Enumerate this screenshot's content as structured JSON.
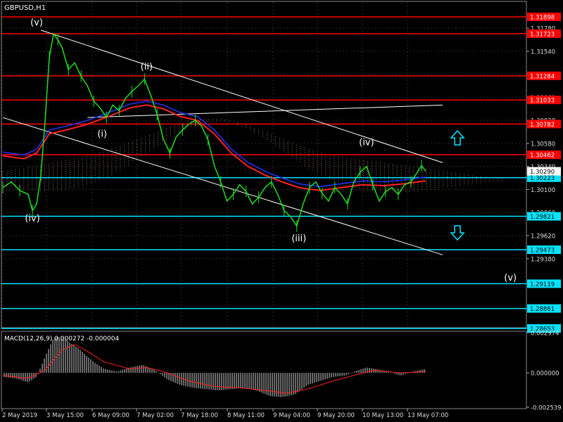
{
  "chart_data": [
    {
      "type": "line",
      "title": "GBPUSD,H1",
      "price_axis_ticks": [
        "1.31780",
        "1.31540",
        "1.31300",
        "1.31060",
        "1.30820",
        "1.30580",
        "1.30340",
        "1.30100",
        "1.29860",
        "1.29620",
        "1.29380"
      ],
      "time_labels": [
        "2 May 2019",
        "3 May 15:00",
        "6 May 09:00",
        "7 May 02:00",
        "7 May 18:00",
        "8 May 11:00",
        "9 May 04:00",
        "9 May 20:00",
        "10 May 13:00",
        "13 May 07:00"
      ],
      "levels": [
        {
          "label": "1.31898",
          "value": 1.31898,
          "color": "#ff0000"
        },
        {
          "label": "1.31723",
          "value": 1.31723,
          "color": "#ff0000"
        },
        {
          "label": "1.31284",
          "value": 1.31284,
          "color": "#ff0000"
        },
        {
          "label": "1.31033",
          "value": 1.31033,
          "color": "#ff0000"
        },
        {
          "label": "1.30782",
          "value": 1.30782,
          "color": "#ff0000"
        },
        {
          "label": "1.30462",
          "value": 1.30462,
          "color": "#ff0000"
        },
        {
          "label": "1.30223",
          "value": 1.30223,
          "color": "#00e5ff"
        },
        {
          "label": "1.29821",
          "value": 1.29821,
          "color": "#00e5ff"
        },
        {
          "label": "1.29473",
          "value": 1.29473,
          "color": "#00e5ff"
        },
        {
          "label": "1.29119",
          "value": 1.29119,
          "color": "#00e5ff"
        },
        {
          "label": "1.28861",
          "value": 1.28861,
          "color": "#00e5ff"
        },
        {
          "label": "1.28653",
          "value": 1.28653,
          "color": "#00e5ff"
        }
      ],
      "current_price": "1.30290",
      "wave_labels": [
        {
          "text": "(v)",
          "t": 0.08,
          "v": 1.3181
        },
        {
          "text": "(i)",
          "t": 0.235,
          "v": 1.3065
        },
        {
          "text": "(ii)",
          "t": 0.34,
          "v": 1.3135
        },
        {
          "text": "(iii)",
          "t": 0.7,
          "v": 1.2956
        },
        {
          "text": "(iv)",
          "t": 0.86,
          "v": 1.3056
        },
        {
          "text": "(iv)",
          "t": 0.07,
          "v": 1.2977
        },
        {
          "text": "(v)",
          "t": 1.2,
          "v": 1.2915
        }
      ],
      "price_series": [
        {
          "t": 0.0,
          "v": 1.3012
        },
        {
          "t": 0.02,
          "v": 1.3018
        },
        {
          "t": 0.04,
          "v": 1.3009
        },
        {
          "t": 0.06,
          "v": 1.3005
        },
        {
          "t": 0.07,
          "v": 1.2988
        },
        {
          "t": 0.08,
          "v": 1.2995
        },
        {
          "t": 0.09,
          "v": 1.3025
        },
        {
          "t": 0.1,
          "v": 1.3082
        },
        {
          "t": 0.11,
          "v": 1.3148
        },
        {
          "t": 0.12,
          "v": 1.3172
        },
        {
          "t": 0.13,
          "v": 1.3166
        },
        {
          "t": 0.14,
          "v": 1.3158
        },
        {
          "t": 0.155,
          "v": 1.3135
        },
        {
          "t": 0.17,
          "v": 1.3142
        },
        {
          "t": 0.185,
          "v": 1.3128
        },
        {
          "t": 0.2,
          "v": 1.3118
        },
        {
          "t": 0.215,
          "v": 1.3102
        },
        {
          "t": 0.23,
          "v": 1.3095
        },
        {
          "t": 0.245,
          "v": 1.3085
        },
        {
          "t": 0.26,
          "v": 1.3098
        },
        {
          "t": 0.275,
          "v": 1.3092
        },
        {
          "t": 0.29,
          "v": 1.3105
        },
        {
          "t": 0.305,
          "v": 1.3112
        },
        {
          "t": 0.32,
          "v": 1.3118
        },
        {
          "t": 0.335,
          "v": 1.3125
        },
        {
          "t": 0.35,
          "v": 1.3108
        },
        {
          "t": 0.365,
          "v": 1.3088
        },
        {
          "t": 0.38,
          "v": 1.3062
        },
        {
          "t": 0.395,
          "v": 1.3048
        },
        {
          "t": 0.41,
          "v": 1.3065
        },
        {
          "t": 0.425,
          "v": 1.3072
        },
        {
          "t": 0.44,
          "v": 1.3078
        },
        {
          "t": 0.455,
          "v": 1.3082
        },
        {
          "t": 0.47,
          "v": 1.3076
        },
        {
          "t": 0.485,
          "v": 1.3062
        },
        {
          "t": 0.5,
          "v": 1.3035
        },
        {
          "t": 0.515,
          "v": 1.3018
        },
        {
          "t": 0.53,
          "v": 1.2998
        },
        {
          "t": 0.545,
          "v": 1.3005
        },
        {
          "t": 0.56,
          "v": 1.3015
        },
        {
          "t": 0.575,
          "v": 1.3008
        },
        {
          "t": 0.59,
          "v": 1.2995
        },
        {
          "t": 0.605,
          "v": 1.3002
        },
        {
          "t": 0.62,
          "v": 1.3012
        },
        {
          "t": 0.635,
          "v": 1.3018
        },
        {
          "t": 0.65,
          "v": 1.3005
        },
        {
          "t": 0.665,
          "v": 1.2988
        },
        {
          "t": 0.68,
          "v": 1.2982
        },
        {
          "t": 0.695,
          "v": 1.2972
        },
        {
          "t": 0.71,
          "v": 1.2995
        },
        {
          "t": 0.725,
          "v": 1.3012
        },
        {
          "t": 0.74,
          "v": 1.3018
        },
        {
          "t": 0.755,
          "v": 1.3006
        },
        {
          "t": 0.77,
          "v": 1.2998
        },
        {
          "t": 0.785,
          "v": 1.3012
        },
        {
          "t": 0.8,
          "v": 1.3005
        },
        {
          "t": 0.815,
          "v": 1.2995
        },
        {
          "t": 0.83,
          "v": 1.3018
        },
        {
          "t": 0.845,
          "v": 1.3028
        },
        {
          "t": 0.86,
          "v": 1.3034
        },
        {
          "t": 0.875,
          "v": 1.3015
        },
        {
          "t": 0.89,
          "v": 1.2998
        },
        {
          "t": 0.905,
          "v": 1.3008
        },
        {
          "t": 0.92,
          "v": 1.3012
        },
        {
          "t": 0.935,
          "v": 1.3005
        },
        {
          "t": 0.95,
          "v": 1.3015
        },
        {
          "t": 0.965,
          "v": 1.3018
        },
        {
          "t": 0.98,
          "v": 1.3028
        },
        {
          "t": 0.99,
          "v": 1.3035
        },
        {
          "t": 1.0,
          "v": 1.3029
        }
      ],
      "ma_series": [
        {
          "t": 0.0,
          "v": 1.3045
        },
        {
          "t": 0.05,
          "v": 1.3042
        },
        {
          "t": 0.08,
          "v": 1.3048
        },
        {
          "t": 0.11,
          "v": 1.3068
        },
        {
          "t": 0.15,
          "v": 1.3072
        },
        {
          "t": 0.2,
          "v": 1.3078
        },
        {
          "t": 0.25,
          "v": 1.3086
        },
        {
          "t": 0.3,
          "v": 1.3095
        },
        {
          "t": 0.34,
          "v": 1.3098
        },
        {
          "t": 0.38,
          "v": 1.3094
        },
        {
          "t": 0.42,
          "v": 1.3086
        },
        {
          "t": 0.46,
          "v": 1.3082
        },
        {
          "t": 0.5,
          "v": 1.3068
        },
        {
          "t": 0.54,
          "v": 1.3048
        },
        {
          "t": 0.58,
          "v": 1.3034
        },
        {
          "t": 0.62,
          "v": 1.3025
        },
        {
          "t": 0.66,
          "v": 1.3018
        },
        {
          "t": 0.7,
          "v": 1.3012
        },
        {
          "t": 0.75,
          "v": 1.3009
        },
        {
          "t": 0.8,
          "v": 1.3012
        },
        {
          "t": 0.85,
          "v": 1.3015
        },
        {
          "t": 0.9,
          "v": 1.3014
        },
        {
          "t": 0.95,
          "v": 1.3016
        },
        {
          "t": 1.0,
          "v": 1.3019
        }
      ],
      "channel_lines": [
        {
          "t1": 0.09,
          "v1": 1.3176,
          "t2": 1.04,
          "v2": 1.3038
        },
        {
          "t1": 0.0,
          "v1": 1.3085,
          "t2": 1.04,
          "v2": 1.2942
        },
        {
          "t1": 0.2,
          "v1": 1.3085,
          "t2": 1.04,
          "v2": 1.3098
        }
      ],
      "arrows": [
        "up",
        "down"
      ],
      "arrow_color": "#00e5ff"
    },
    {
      "type": "bar",
      "title": "MACD(12,26,9) 0.000272 -0.000004",
      "axis_ticks": [
        "0.002974",
        "0.000000",
        "-0.002539"
      ],
      "ylim": [
        -0.002539,
        0.002974
      ],
      "histogram": [
        {
          "t": 0.0,
          "v": -0.0003
        },
        {
          "t": 0.03,
          "v": -0.0004
        },
        {
          "t": 0.06,
          "v": -0.0007
        },
        {
          "t": 0.08,
          "v": -0.0003
        },
        {
          "t": 0.1,
          "v": 0.0012
        },
        {
          "t": 0.12,
          "v": 0.0026
        },
        {
          "t": 0.14,
          "v": 0.0027
        },
        {
          "t": 0.16,
          "v": 0.0022
        },
        {
          "t": 0.18,
          "v": 0.0018
        },
        {
          "t": 0.2,
          "v": 0.0012
        },
        {
          "t": 0.22,
          "v": 0.0007
        },
        {
          "t": 0.24,
          "v": 0.0003
        },
        {
          "t": 0.27,
          "v": 0.0001
        },
        {
          "t": 0.3,
          "v": 0.0004
        },
        {
          "t": 0.33,
          "v": 0.0006
        },
        {
          "t": 0.36,
          "v": 0.0002
        },
        {
          "t": 0.39,
          "v": -0.0005
        },
        {
          "t": 0.42,
          "v": -0.0009
        },
        {
          "t": 0.45,
          "v": -0.0011
        },
        {
          "t": 0.48,
          "v": -0.0012
        },
        {
          "t": 0.51,
          "v": -0.0013
        },
        {
          "t": 0.54,
          "v": -0.0012
        },
        {
          "t": 0.57,
          "v": -0.0011
        },
        {
          "t": 0.6,
          "v": -0.0013
        },
        {
          "t": 0.63,
          "v": -0.0017
        },
        {
          "t": 0.66,
          "v": -0.0018
        },
        {
          "t": 0.69,
          "v": -0.0016
        },
        {
          "t": 0.72,
          "v": -0.0009
        },
        {
          "t": 0.75,
          "v": -0.0006
        },
        {
          "t": 0.78,
          "v": -0.0003
        },
        {
          "t": 0.81,
          "v": -0.0002
        },
        {
          "t": 0.84,
          "v": 0.0002
        },
        {
          "t": 0.86,
          "v": 0.0004
        },
        {
          "t": 0.88,
          "v": 0.0003
        },
        {
          "t": 0.91,
          "v": 0.0001
        },
        {
          "t": 0.94,
          "v": -0.0002
        },
        {
          "t": 0.97,
          "v": 0.0001
        },
        {
          "t": 1.0,
          "v": 0.0003
        }
      ],
      "signal": [
        {
          "t": 0.0,
          "v": -0.0002
        },
        {
          "t": 0.06,
          "v": -0.0004
        },
        {
          "t": 0.1,
          "v": 0.0002
        },
        {
          "t": 0.14,
          "v": 0.0017
        },
        {
          "t": 0.17,
          "v": 0.0021
        },
        {
          "t": 0.2,
          "v": 0.0016
        },
        {
          "t": 0.24,
          "v": 0.0008
        },
        {
          "t": 0.3,
          "v": 0.0003
        },
        {
          "t": 0.34,
          "v": 0.0004
        },
        {
          "t": 0.38,
          "v": 0.0001
        },
        {
          "t": 0.44,
          "v": -0.0006
        },
        {
          "t": 0.5,
          "v": -0.001
        },
        {
          "t": 0.56,
          "v": -0.0011
        },
        {
          "t": 0.62,
          "v": -0.0013
        },
        {
          "t": 0.67,
          "v": -0.0015
        },
        {
          "t": 0.72,
          "v": -0.0012
        },
        {
          "t": 0.78,
          "v": -0.0006
        },
        {
          "t": 0.84,
          "v": -0.0001
        },
        {
          "t": 0.88,
          "v": 0.0002
        },
        {
          "t": 0.94,
          "v": 0.0
        },
        {
          "t": 1.0,
          "v": 0.0001
        }
      ]
    }
  ]
}
